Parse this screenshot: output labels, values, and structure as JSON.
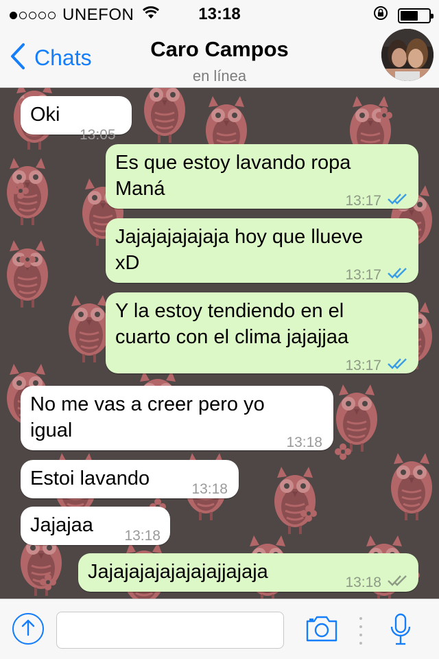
{
  "status_bar": {
    "carrier": "UNEFON",
    "time": "13:18",
    "signal_bars_filled": 1,
    "signal_bars_total": 5
  },
  "nav": {
    "back_label": "Chats",
    "contact_name": "Caro Campos",
    "presence": "en línea"
  },
  "messages": [
    {
      "direction": "in",
      "text": "Oki",
      "time": "13:05"
    },
    {
      "direction": "out",
      "text": "Es que estoy lavando ropa\nManá",
      "time": "13:17",
      "status": "read"
    },
    {
      "direction": "out",
      "text": "Jajajajajajaja hoy que llueve\nxD",
      "time": "13:17",
      "status": "read"
    },
    {
      "direction": "out",
      "text": "Y la estoy tendiendo en el\ncuarto con el clima jajajjaa",
      "time": "13:17",
      "status": "read"
    },
    {
      "direction": "in",
      "text": "No me vas a creer pero yo\nigual",
      "time": "13:18"
    },
    {
      "direction": "in",
      "text": "Estoi lavando",
      "time": "13:18"
    },
    {
      "direction": "in",
      "text": "Jajajaa",
      "time": "13:18"
    },
    {
      "direction": "out",
      "text": "Jajajajajajajajajjajaja",
      "time": "13:18",
      "status": "delivered"
    }
  ],
  "input": {
    "value": "",
    "placeholder": ""
  },
  "colors": {
    "accent": "#157efb",
    "outgoing_bubble": "#dcf8c6",
    "incoming_bubble": "#ffffff",
    "read_tick": "#3a9de6",
    "delivered_tick": "#8e9a86"
  },
  "icons": {
    "back": "chevron-left-icon",
    "wifi": "wifi-icon",
    "lock": "rotation-lock-icon",
    "battery": "battery-icon",
    "attach": "upload-arrow-icon",
    "camera": "camera-icon",
    "mic": "microphone-icon"
  }
}
